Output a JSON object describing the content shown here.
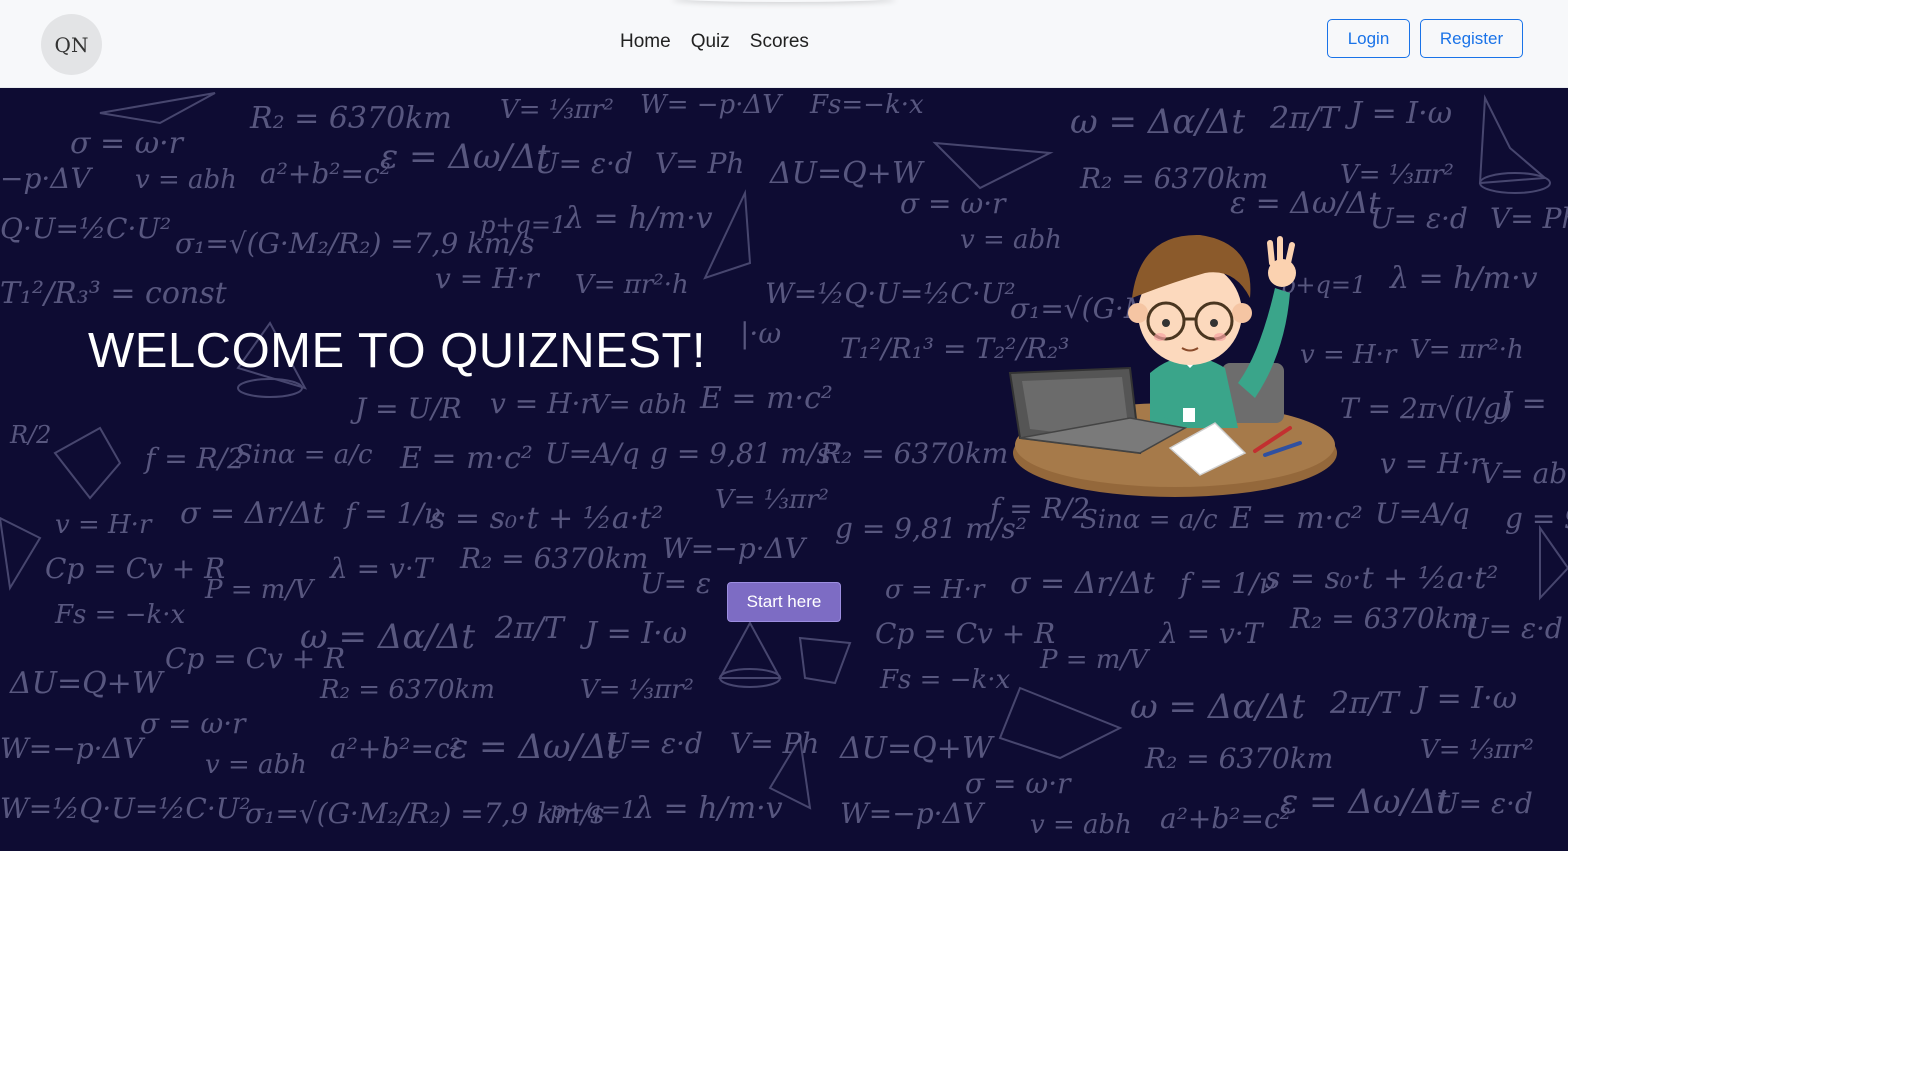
{
  "app": {
    "logo_text": "QN",
    "logo_icon": "quiznest-logo"
  },
  "nav": {
    "links": [
      {
        "label": "Home"
      },
      {
        "label": "Quiz"
      },
      {
        "label": "Scores"
      }
    ],
    "login_label": "Login",
    "register_label": "Register"
  },
  "hero": {
    "title": "WELCOME TO QUIZNEST!",
    "cta_label": "Start here",
    "background": "math-formulas-chalkboard",
    "illustration": "student-with-laptop-raising-hand"
  },
  "colors": {
    "nav_bg": "#f7f8fa",
    "accent_blue": "#1a73e8",
    "hero_bg": "#0e0c33",
    "cta_purple": "#7d6cc4"
  }
}
